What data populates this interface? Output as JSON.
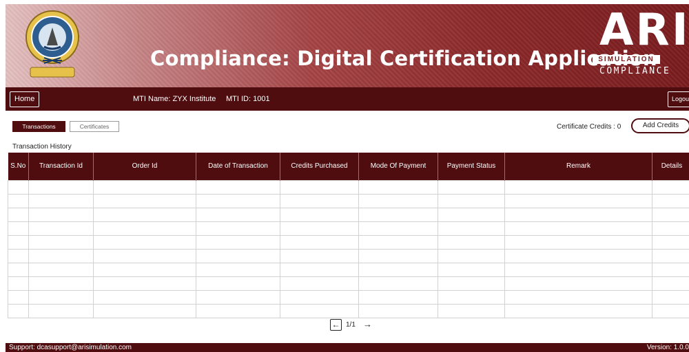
{
  "header": {
    "app_title": "Compliance: Digital Certification Application",
    "brand_mark": "ARI",
    "brand_sub1": "SIMULATION",
    "brand_sub2": "COMPLIANCE",
    "logo_icon": "dg-shipping-emblem"
  },
  "nav": {
    "home_label": "Home",
    "mti_name": "MTI Name: ZYX Institute",
    "mti_id": "MTI ID: 1001",
    "logout_label": "Logout"
  },
  "tabs": [
    {
      "label": "Transactions",
      "active": true
    },
    {
      "label": "Certificates",
      "active": false
    }
  ],
  "credits": {
    "label": "Certificate Credits : 0",
    "add_label": "Add Credits"
  },
  "section_title": "Transaction History",
  "table": {
    "columns": [
      "S.No",
      "Transaction Id",
      "Order Id",
      "Date of Transaction",
      "Credits Purchased",
      "Mode Of Payment",
      "Payment Status",
      "Remark",
      "Details"
    ],
    "empty_row_count": 10
  },
  "pager": {
    "prev_icon": "arrow-left-icon",
    "page_text": "1/1",
    "next_icon": "arrow-right-icon"
  },
  "footer": {
    "support": "Support: dcasupport@arisimulation.com",
    "version": "Version: 1.0.0"
  },
  "colors": {
    "primary": "#4f0d0f",
    "banner_dark": "#7a1c1e"
  }
}
